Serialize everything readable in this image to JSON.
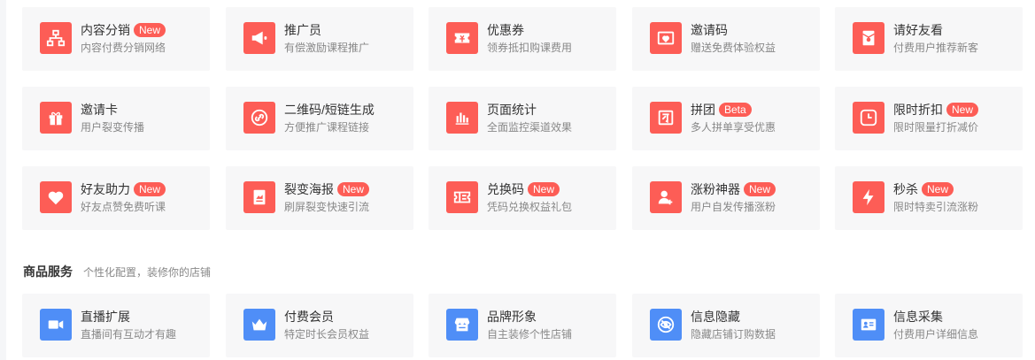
{
  "rows": [
    [
      {
        "id": "content-distribution",
        "title": "内容分销",
        "badge": "New",
        "desc": "内容付费分销网络",
        "icon": "org-chart-icon",
        "color": "red"
      },
      {
        "id": "promoter",
        "title": "推广员",
        "badge": "",
        "desc": "有偿激励课程推广",
        "icon": "megaphone-icon",
        "color": "red"
      },
      {
        "id": "coupon",
        "title": "优惠券",
        "badge": "",
        "desc": "领券抵扣购课费用",
        "icon": "coupon-icon",
        "color": "red"
      },
      {
        "id": "invite-code",
        "title": "邀请码",
        "badge": "",
        "desc": "赠送免费体验权益",
        "icon": "envelope-heart-icon",
        "color": "red"
      },
      {
        "id": "friend-pay",
        "title": "请好友看",
        "badge": "",
        "desc": "付费用户推荐新客",
        "icon": "red-packet-icon",
        "color": "red"
      }
    ],
    [
      {
        "id": "invite-card",
        "title": "邀请卡",
        "badge": "",
        "desc": "用户裂变传播",
        "icon": "gift-icon",
        "color": "red"
      },
      {
        "id": "qrcode-shortlink",
        "title": "二维码/短链生成",
        "badge": "",
        "desc": "方便推广课程链接",
        "icon": "link-icon",
        "color": "red"
      },
      {
        "id": "page-stats",
        "title": "页面统计",
        "badge": "",
        "desc": "全面监控渠道效果",
        "icon": "bar-chart-icon",
        "color": "red"
      },
      {
        "id": "group-buy",
        "title": "拼团",
        "badge": "Beta",
        "desc": "多人拼单享受优惠",
        "icon": "group-icon",
        "color": "red"
      },
      {
        "id": "limited-discount",
        "title": "限时折扣",
        "badge": "New",
        "desc": "限时限量打折减价",
        "icon": "clock-icon",
        "color": "red"
      }
    ],
    [
      {
        "id": "friend-assist",
        "title": "好友助力",
        "badge": "New",
        "desc": "好友点赞免费听课",
        "icon": "heart-icon",
        "color": "red"
      },
      {
        "id": "fission-poster",
        "title": "裂变海报",
        "badge": "New",
        "desc": "刷屏裂变快速引流",
        "icon": "poster-icon",
        "color": "red"
      },
      {
        "id": "redeem-code",
        "title": "兑换码",
        "badge": "New",
        "desc": "凭码兑换权益礼包",
        "icon": "ticket-icon",
        "color": "red"
      },
      {
        "id": "follower-growth",
        "title": "涨粉神器",
        "badge": "New",
        "desc": "用户自发传播涨粉",
        "icon": "user-add-icon",
        "color": "red"
      },
      {
        "id": "flash-sale",
        "title": "秒杀",
        "badge": "New",
        "desc": "限时特卖引流涨粉",
        "icon": "lightning-icon",
        "color": "red"
      }
    ]
  ],
  "section": {
    "title": "商品服务",
    "subtitle": "个性化配置，装修你的店铺"
  },
  "service_row": [
    {
      "id": "live-extension",
      "title": "直播扩展",
      "badge": "",
      "desc": "直播间有互动才有趣",
      "icon": "video-camera-icon",
      "color": "blue"
    },
    {
      "id": "paid-membership",
      "title": "付费会员",
      "badge": "",
      "desc": "特定时长会员权益",
      "icon": "crown-icon",
      "color": "blue"
    },
    {
      "id": "brand-image",
      "title": "品牌形象",
      "badge": "",
      "desc": "自主装修个性店铺",
      "icon": "storefront-icon",
      "color": "blue"
    },
    {
      "id": "info-hiding",
      "title": "信息隐藏",
      "badge": "",
      "desc": "隐藏店铺订购数据",
      "icon": "eye-hidden-icon",
      "color": "blue"
    },
    {
      "id": "info-collection",
      "title": "信息采集",
      "badge": "",
      "desc": "付费用户详细信息",
      "icon": "id-card-icon",
      "color": "blue"
    }
  ]
}
